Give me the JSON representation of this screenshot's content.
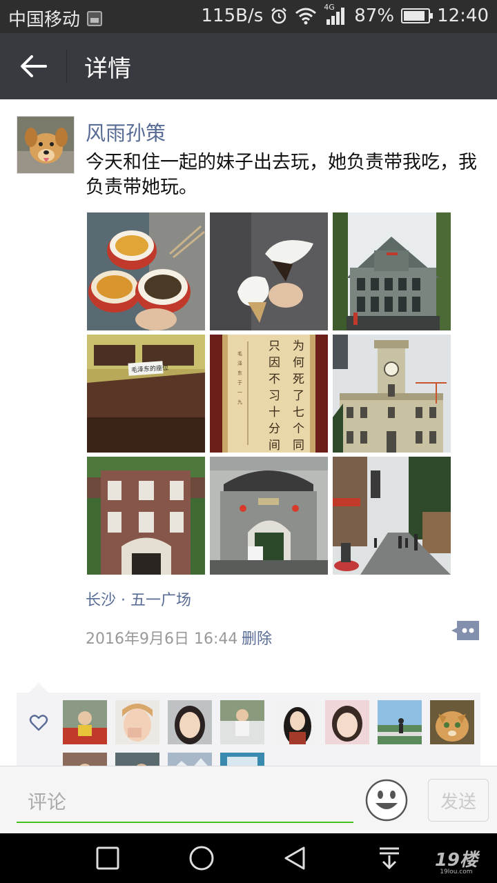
{
  "status_bar": {
    "carrier": "中国移动",
    "net_speed": "115B/s",
    "network_type": "4G",
    "battery": "87%",
    "battery_level": 0.87,
    "time": "12:40"
  },
  "header": {
    "title": "详情"
  },
  "post": {
    "author": "风雨孙策",
    "text": "今天和住一起的妹子出去玩，她负责带我吃，我负责带她玩。",
    "photos": [
      {
        "icon": "photo-food"
      },
      {
        "icon": "photo-ice-cream"
      },
      {
        "icon": "photo-building"
      },
      {
        "icon": "photo-desk",
        "caption": "毛泽东的座位"
      },
      {
        "icon": "photo-inscription",
        "caption": "为何死了七个同学 只因不习十分间操"
      },
      {
        "icon": "photo-clock-tower"
      },
      {
        "icon": "photo-brick-building"
      },
      {
        "icon": "photo-gate"
      },
      {
        "icon": "photo-street"
      }
    ],
    "location": "长沙 · 五一广场",
    "timestamp": "2016年9月6日 16:44",
    "delete_label": "删除"
  },
  "likes": {
    "count_visible": 12
  },
  "comment_bar": {
    "placeholder": "评论",
    "send_label": "发送"
  },
  "watermark": {
    "logo": "19楼",
    "site": "19lou.com"
  },
  "colors": {
    "link": "#576b95",
    "title_bar": "#393a3f",
    "status_bar": "#2e2e2e",
    "input_underline": "#45c01a"
  }
}
